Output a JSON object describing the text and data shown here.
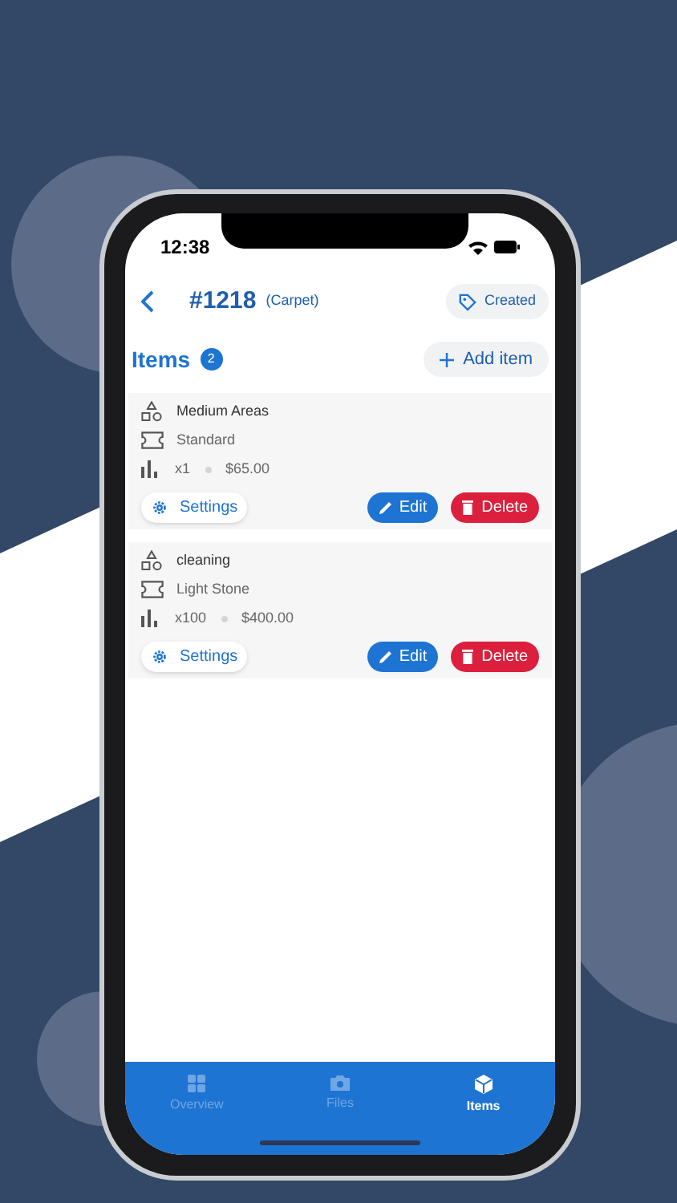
{
  "status_bar": {
    "time": "12:38"
  },
  "header": {
    "title": "#1218",
    "subtitle": "(Carpet)",
    "status": "Created"
  },
  "section": {
    "title": "Items",
    "count": "2",
    "add_label": "Add item"
  },
  "items": [
    {
      "name": "Medium Areas",
      "type": "Standard",
      "quantity": "x1",
      "price": "$65.00",
      "settings_label": "Settings",
      "edit_label": "Edit",
      "delete_label": "Delete"
    },
    {
      "name": "cleaning",
      "type": "Light Stone",
      "quantity": "x100",
      "price": "$400.00",
      "settings_label": "Settings",
      "edit_label": "Edit",
      "delete_label": "Delete"
    }
  ],
  "tab_bar": [
    {
      "label": "Overview",
      "selected": false
    },
    {
      "label": "Files",
      "selected": false
    },
    {
      "label": "Items",
      "selected": true
    }
  ]
}
